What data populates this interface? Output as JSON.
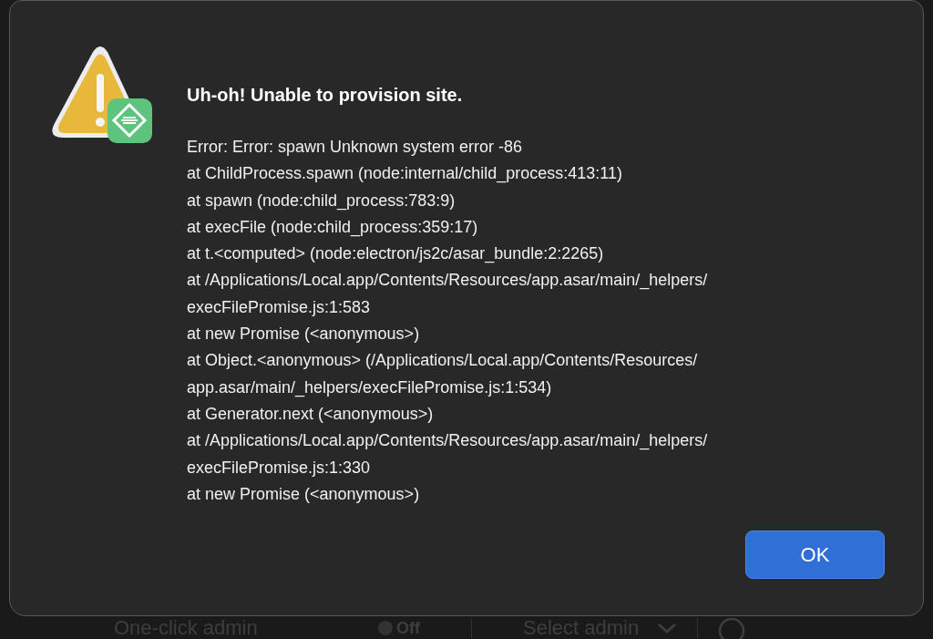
{
  "dialog": {
    "title": "Uh-oh! Unable to provision site.",
    "message_lines": [
      "Error: Error: spawn Unknown system error -86",
      "at ChildProcess.spawn (node:internal/child_process:413:11)",
      "at spawn (node:child_process:783:9)",
      "at execFile (node:child_process:359:17)",
      "at t.<computed> (node:electron/js2c/asar_bundle:2:2265)",
      "at /Applications/Local.app/Contents/Resources/app.asar/main/_helpers/",
      "execFilePromise.js:1:583",
      "at new Promise (<anonymous>)",
      "at Object.<anonymous> (/Applications/Local.app/Contents/Resources/",
      "app.asar/main/_helpers/execFilePromise.js:1:534)",
      "at Generator.next (<anonymous>)",
      "at /Applications/Local.app/Contents/Resources/app.asar/main/_helpers/",
      "execFilePromise.js:1:330",
      "at new Promise (<anonymous>)"
    ],
    "buttons": [
      "OK"
    ]
  },
  "background_row": {
    "label": "One-click admin",
    "toggle": {
      "on": false,
      "label": "Off"
    },
    "select": {
      "placeholder": "Select admin"
    }
  }
}
